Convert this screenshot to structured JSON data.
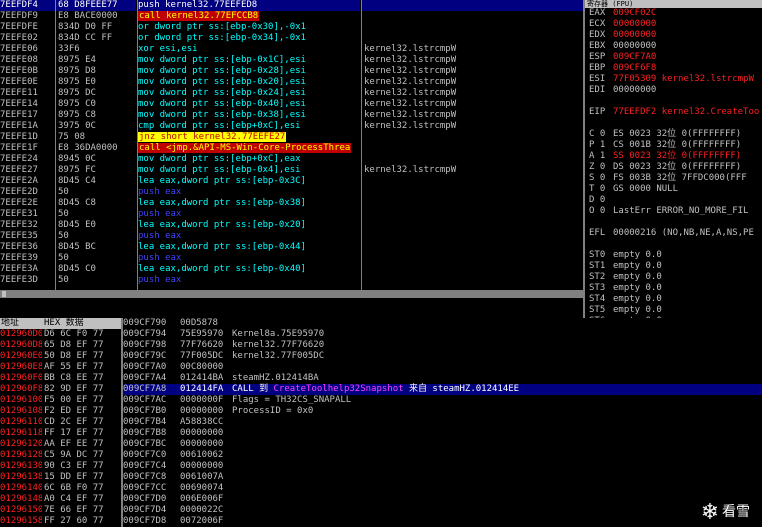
{
  "cpu": {
    "rows": [
      {
        "addr": "7EEFDF4",
        "hex": "68 D8FEEE77",
        "asm": "push kernel32.77EEFED8",
        "cmt": "",
        "kind": "push",
        "hl": true
      },
      {
        "addr": "7EEFDF9",
        "hex": "E8 BACE0000",
        "asm": "call kernel32.77EFCCB8",
        "cmt": "",
        "kind": "call"
      },
      {
        "addr": "7EEFDFE",
        "hex": "834D D0 FF",
        "asm": "or dword ptr ss:[ebp-0x30],-0x1",
        "cmt": "",
        "kind": "mov"
      },
      {
        "addr": "7EEFE02",
        "hex": "834D CC FF",
        "asm": "or dword ptr ss:[ebp-0x34],-0x1",
        "cmt": "",
        "kind": "mov"
      },
      {
        "addr": "7EEFE06",
        "hex": "33F6",
        "asm": "xor esi,esi",
        "cmt": "kernel32.lstrcmpW",
        "kind": "xor"
      },
      {
        "addr": "7EEFE08",
        "hex": "8975 E4",
        "asm": "mov dword ptr ss:[ebp-0x1C],esi",
        "cmt": "kernel32.lstrcmpW",
        "kind": "mov"
      },
      {
        "addr": "7EEFE0B",
        "hex": "8975 D8",
        "asm": "mov dword ptr ss:[ebp-0x28],esi",
        "cmt": "kernel32.lstrcmpW",
        "kind": "mov"
      },
      {
        "addr": "7EEFE0E",
        "hex": "8975 E0",
        "asm": "mov dword ptr ss:[ebp-0x20],esi",
        "cmt": "kernel32.lstrcmpW",
        "kind": "mov"
      },
      {
        "addr": "7EEFE11",
        "hex": "8975 DC",
        "asm": "mov dword ptr ss:[ebp-0x24],esi",
        "cmt": "kernel32.lstrcmpW",
        "kind": "mov"
      },
      {
        "addr": "7EEFE14",
        "hex": "8975 C0",
        "asm": "mov dword ptr ss:[ebp-0x40],esi",
        "cmt": "kernel32.lstrcmpW",
        "kind": "mov"
      },
      {
        "addr": "7EEFE17",
        "hex": "8975 C8",
        "asm": "mov dword ptr ss:[ebp-0x38],esi",
        "cmt": "kernel32.lstrcmpW",
        "kind": "mov"
      },
      {
        "addr": "7EEFE1A",
        "hex": "3975 0C",
        "asm": "cmp dword ptr ss:[ebp+0xC],esi",
        "cmt": "kernel32.lstrcmpW",
        "kind": "cmp"
      },
      {
        "addr": "7EEFE1D",
        "hex": "75 08",
        "asm": "jnz short kernel32.77EEFE27",
        "cmt": "",
        "kind": "jmp"
      },
      {
        "addr": "7EEFE1F",
        "hex": "E8 36DA0000",
        "asm": "call <jmp.&API-MS-Win-Core-ProcessThrea",
        "cmt": "",
        "kind": "call"
      },
      {
        "addr": "7EEFE24",
        "hex": "8945 0C",
        "asm": "mov dword ptr ss:[ebp+0xC],eax",
        "cmt": "",
        "kind": "mov"
      },
      {
        "addr": "7EEFE27",
        "hex": "8975 FC",
        "asm": "mov dword ptr ss:[ebp-0x4],esi",
        "cmt": "kernel32.lstrcmpW",
        "kind": "mov"
      },
      {
        "addr": "7EEFE2A",
        "hex": "8D45 C4",
        "asm": "lea eax,dword ptr ss:[ebp-0x3C]",
        "cmt": "",
        "kind": "lea"
      },
      {
        "addr": "7EEFE2D",
        "hex": "50",
        "asm": "push eax",
        "cmt": "",
        "kind": "push"
      },
      {
        "addr": "7EEFE2E",
        "hex": "8D45 C8",
        "asm": "lea eax,dword ptr ss:[ebp-0x38]",
        "cmt": "",
        "kind": "lea"
      },
      {
        "addr": "7EEFE31",
        "hex": "50",
        "asm": "push eax",
        "cmt": "",
        "kind": "push"
      },
      {
        "addr": "7EEFE32",
        "hex": "8D45 E0",
        "asm": "lea eax,dword ptr ss:[ebp-0x20]",
        "cmt": "",
        "kind": "lea"
      },
      {
        "addr": "7EEFE35",
        "hex": "50",
        "asm": "push eax",
        "cmt": "",
        "kind": "push"
      },
      {
        "addr": "7EEFE36",
        "hex": "8D45 BC",
        "asm": "lea eax,dword ptr ss:[ebp-0x44]",
        "cmt": "",
        "kind": "lea"
      },
      {
        "addr": "7EEFE39",
        "hex": "50",
        "asm": "push eax",
        "cmt": "",
        "kind": "push"
      },
      {
        "addr": "7EEFE3A",
        "hex": "8D45 C0",
        "asm": "lea eax,dword ptr ss:[ebp-0x40]",
        "cmt": "",
        "kind": "lea"
      },
      {
        "addr": "7EEFE3D",
        "hex": "50",
        "asm": "push eax",
        "cmt": "",
        "kind": "push"
      }
    ]
  },
  "registers": {
    "title": "寄存器 (FPU)",
    "lines": [
      {
        "lbl": "EAX",
        "val": "009CF02C",
        "red": true
      },
      {
        "lbl": "ECX",
        "val": "00000000",
        "red": true
      },
      {
        "lbl": "EDX",
        "val": "00000000",
        "red": true
      },
      {
        "lbl": "EBX",
        "val": "00000000",
        "red": false
      },
      {
        "lbl": "ESP",
        "val": "009CF7A0",
        "red": true
      },
      {
        "lbl": "EBP",
        "val": "009CF6F8",
        "red": true
      },
      {
        "lbl": "ESI",
        "val": "77F05309 kernel32.lstrcmpW",
        "red": true
      },
      {
        "lbl": "EDI",
        "val": "00000000",
        "red": false
      },
      {
        "lbl": "",
        "val": "",
        "red": false
      },
      {
        "lbl": "EIP",
        "val": "77EEFDF2 kernel32.CreateToo",
        "red": true
      },
      {
        "lbl": "",
        "val": "",
        "red": false
      },
      {
        "lbl": "C 0",
        "val": "ES 0023 32位 0(FFFFFFFF)",
        "red": false
      },
      {
        "lbl": "P 1",
        "val": "CS 001B 32位 0(FFFFFFFF)",
        "red": false
      },
      {
        "lbl": "A 1",
        "val": "SS 0023 32位 0(FFFFFFFF)",
        "red": true
      },
      {
        "lbl": "Z 0",
        "val": "DS 0023 32位 0(FFFFFFFF)",
        "red": false
      },
      {
        "lbl": "S 0",
        "val": "FS 003B 32位 7FFDC000(FFF",
        "red": false
      },
      {
        "lbl": "T 0",
        "val": "GS 0000 NULL",
        "red": false
      },
      {
        "lbl": "D 0",
        "val": "",
        "red": false
      },
      {
        "lbl": "O 0",
        "val": "LastErr ERROR_NO_MORE_FIL",
        "red": false
      },
      {
        "lbl": "",
        "val": "",
        "red": false
      },
      {
        "lbl": "EFL",
        "val": "00000216 (NO,NB,NE,A,NS,PE",
        "red": false
      },
      {
        "lbl": "",
        "val": "",
        "red": false
      },
      {
        "lbl": "ST0",
        "val": "empty 0.0",
        "red": false
      },
      {
        "lbl": "ST1",
        "val": "empty 0.0",
        "red": false
      },
      {
        "lbl": "ST2",
        "val": "empty 0.0",
        "red": false
      },
      {
        "lbl": "ST3",
        "val": "empty 0.0",
        "red": false
      },
      {
        "lbl": "ST4",
        "val": "empty 0.0",
        "red": false
      },
      {
        "lbl": "ST5",
        "val": "empty 0.0",
        "red": false
      },
      {
        "lbl": "ST6",
        "val": "empty 0.0",
        "red": false
      },
      {
        "lbl": "ST7",
        "val": "empty 0.0",
        "red": false
      }
    ]
  },
  "dump": {
    "hdr_addr": "地址",
    "hdr_hex": "HEX 数据",
    "rows": [
      {
        "addr": "012960D0",
        "hex": "D6 6C F0 77"
      },
      {
        "addr": "012960D8",
        "hex": "65 D8 EF 77"
      },
      {
        "addr": "012960E0",
        "hex": "50 D8 EF 77"
      },
      {
        "addr": "012960E8",
        "hex": "AF 55 EF 77"
      },
      {
        "addr": "012960F0",
        "hex": "BB C8 EE 77"
      },
      {
        "addr": "012960F8",
        "hex": "82 9D EF 77"
      },
      {
        "addr": "01296100",
        "hex": "F5 00 EF 77"
      },
      {
        "addr": "01296108",
        "hex": "F2 ED EF 77"
      },
      {
        "addr": "01296110",
        "hex": "CD 2C EF 77"
      },
      {
        "addr": "01296118",
        "hex": "FF 17 EF 77"
      },
      {
        "addr": "01296120",
        "hex": "AA EF EE 77"
      },
      {
        "addr": "01296128",
        "hex": "C5 9A DC 77"
      },
      {
        "addr": "01296130",
        "hex": "90 C3 EF 77"
      },
      {
        "addr": "01296138",
        "hex": "15 DD EF 77"
      },
      {
        "addr": "01296140",
        "hex": "6C 6B F0 77"
      },
      {
        "addr": "01296148",
        "hex": "A0 C4 EF 77"
      },
      {
        "addr": "01296150",
        "hex": "7E 66 EF 77"
      },
      {
        "addr": "01296158",
        "hex": "FF 27 60 77"
      }
    ]
  },
  "stack": {
    "rows": [
      {
        "addr": "009CF790",
        "val": "00D5878",
        "cmt": ""
      },
      {
        "addr": "009CF794",
        "val": "75E95970",
        "cmt": "Kernel8a.75E95970"
      },
      {
        "addr": "009CF798",
        "val": "77F76620",
        "cmt": "kernel32.77F76620"
      },
      {
        "addr": "009CF79C",
        "val": "77F005DC",
        "cmt": "kernel32.77F005DC"
      },
      {
        "addr": "009CF7A0",
        "val": "00C80000",
        "cmt": ""
      },
      {
        "addr": "009CF7A4",
        "val": "012414BA",
        "cmt": "steamHZ.012414BA"
      },
      {
        "addr": "009CF7A8",
        "val": "012414FA",
        "cmt": "CALL 到 CreateToolhelp32Snapshot 来自 steamHZ.012414EE",
        "sel": true
      },
      {
        "addr": "009CF7AC",
        "val": "0000000F",
        "cmt": "Flags = TH32CS_SNAPALL"
      },
      {
        "addr": "009CF7B0",
        "val": "00000000",
        "cmt": "ProcessID = 0x0"
      },
      {
        "addr": "009CF7B4",
        "val": "A58838CC",
        "cmt": ""
      },
      {
        "addr": "009CF7B8",
        "val": "00000000",
        "cmt": ""
      },
      {
        "addr": "009CF7BC",
        "val": "00000000",
        "cmt": ""
      },
      {
        "addr": "009CF7C0",
        "val": "00610062",
        "cmt": ""
      },
      {
        "addr": "009CF7C4",
        "val": "00000000",
        "cmt": ""
      },
      {
        "addr": "009CF7C8",
        "val": "0061007A",
        "cmt": ""
      },
      {
        "addr": "009CF7CC",
        "val": "00690074",
        "cmt": ""
      },
      {
        "addr": "009CF7D0",
        "val": "006E006F",
        "cmt": ""
      },
      {
        "addr": "009CF7D4",
        "val": "0000022C",
        "cmt": ""
      },
      {
        "addr": "009CF7D8",
        "val": "0072006F",
        "cmt": ""
      }
    ],
    "call_prefix": "CALL 到 ",
    "call_target": "CreateToolhelp32Snapshot",
    "call_suffix": " 来自 steamHZ.012414EE"
  },
  "watermark": {
    "text": "看雪",
    "icon": "snowflake-icon"
  }
}
